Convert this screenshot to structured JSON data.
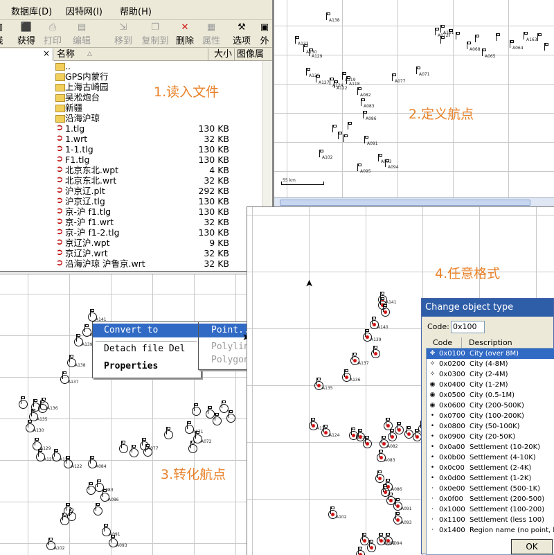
{
  "explorer": {
    "menu": [
      "数据库(D)",
      "因特网(I)",
      "帮助(H)"
    ],
    "toolbar": [
      {
        "label": "线",
        "icon": "gps-device-icon"
      },
      {
        "label": "获得",
        "icon": "gps-receiver-icon"
      },
      {
        "label": "打印",
        "icon": "printer-icon"
      },
      {
        "label": "编辑",
        "icon": "edit-icon"
      },
      {
        "label": "移到",
        "icon": "move-to-icon"
      },
      {
        "label": "复制到",
        "icon": "copy-to-icon"
      },
      {
        "label": "删除",
        "icon": "delete-icon"
      },
      {
        "label": "属性",
        "icon": "properties-icon"
      },
      {
        "label": "选项",
        "icon": "options-icon"
      },
      {
        "label": "外",
        "icon": "external-icon"
      }
    ],
    "pane_close": "×",
    "columns": {
      "name": "名称",
      "size": "大小",
      "attr": "图像属"
    },
    "files": [
      {
        "name": "..",
        "size": "",
        "kind": "folder"
      },
      {
        "name": "GPS内蒙行",
        "size": "",
        "kind": "folder"
      },
      {
        "name": "上海古崎园",
        "size": "",
        "kind": "folder"
      },
      {
        "name": "吴淞炮台",
        "size": "",
        "kind": "folder"
      },
      {
        "name": "新疆",
        "size": "",
        "kind": "folder"
      },
      {
        "name": "沿海沪琼",
        "size": "",
        "kind": "folder"
      },
      {
        "name": "1.tlg",
        "size": "130 KB",
        "kind": "gps"
      },
      {
        "name": "1.wrt",
        "size": "32 KB",
        "kind": "gps"
      },
      {
        "name": "1-1.tlg",
        "size": "130 KB",
        "kind": "gps"
      },
      {
        "name": "F1.tlg",
        "size": "130 KB",
        "kind": "gps"
      },
      {
        "name": "北京东北.wpt",
        "size": "4 KB",
        "kind": "gps"
      },
      {
        "name": "北京东北.wrt",
        "size": "32 KB",
        "kind": "gps"
      },
      {
        "name": "沪京辽.plt",
        "size": "292 KB",
        "kind": "gps"
      },
      {
        "name": "沪京辽.tlg",
        "size": "130 KB",
        "kind": "gps"
      },
      {
        "name": "京-沪 f1.tlg",
        "size": "130 KB",
        "kind": "gps"
      },
      {
        "name": "京-沪 f1.wrt",
        "size": "32 KB",
        "kind": "gps"
      },
      {
        "name": "京-沪 f1-2.tlg",
        "size": "130 KB",
        "kind": "gps"
      },
      {
        "name": "京辽沪.wpt",
        "size": "9 KB",
        "kind": "gps"
      },
      {
        "name": "京辽沪.wrt",
        "size": "32 KB",
        "kind": "gps"
      },
      {
        "name": "沿海沪琼 沪鲁京.wrt",
        "size": "32 KB",
        "kind": "gps"
      }
    ]
  },
  "steps": {
    "s1": "1.读入文件",
    "s2": "2.定义航点",
    "s3": "3.转化航点",
    "s4": "4.任意格式"
  },
  "map2": {
    "scale": "55 km",
    "labels": [
      "A138",
      "A133",
      "A130",
      "A129",
      "A128",
      "A127",
      "A124",
      "A122",
      "A119",
      "A118",
      "A082",
      "A083",
      "A086",
      "A077",
      "A071",
      "A072",
      "A068",
      "A065",
      "A064",
      "A163",
      "A101",
      "A091",
      "A093",
      "A094",
      "A095",
      "A102"
    ]
  },
  "map3": {
    "labels": [
      "A141",
      "A140",
      "A139",
      "A138",
      "A137",
      "A136",
      "A135",
      "A130",
      "A129",
      "A127",
      "A124",
      "A122",
      "A084",
      "A083",
      "A086",
      "A077",
      "A071",
      "A072",
      "A091",
      "A093",
      "A102"
    ]
  },
  "context_menu": {
    "items": [
      "Convert to",
      "Detach file  Del",
      "Properties"
    ],
    "submenu": [
      "Point...",
      "Polyline",
      "Polygon"
    ]
  },
  "map4": {
    "labels": [
      "A141",
      "A140",
      "A139",
      "A137",
      "A136",
      "A135",
      "A127",
      "A124",
      "A122",
      "A083",
      "A082",
      "A086",
      "A091",
      "A093",
      "A094",
      "A095",
      "A102"
    ]
  },
  "dialog": {
    "title": "Change object type",
    "code_label": "Code:",
    "code_value": "0x100",
    "col_code": "Code",
    "col_desc": "Description",
    "ok": "OK",
    "rows": [
      {
        "code": "0x0100",
        "desc": "City (over 8M)",
        "sym": "✥"
      },
      {
        "code": "0x0200",
        "desc": "City (4-8M)",
        "sym": "✧"
      },
      {
        "code": "0x0300",
        "desc": "City (2-4M)",
        "sym": "✧"
      },
      {
        "code": "0x0400",
        "desc": "City (1-2M)",
        "sym": "◉"
      },
      {
        "code": "0x0500",
        "desc": "City (0.5-1M)",
        "sym": "◉"
      },
      {
        "code": "0x0600",
        "desc": "City (200-500K)",
        "sym": "◉"
      },
      {
        "code": "0x0700",
        "desc": "City (100-200K)",
        "sym": "•"
      },
      {
        "code": "0x0800",
        "desc": "City (50-100K)",
        "sym": "•"
      },
      {
        "code": "0x0900",
        "desc": "City (20-50K)",
        "sym": "•"
      },
      {
        "code": "0x0a00",
        "desc": "Settlement (10-20K)",
        "sym": "•"
      },
      {
        "code": "0x0b00",
        "desc": "Settlement (4-10K)",
        "sym": "•"
      },
      {
        "code": "0x0c00",
        "desc": "Settlement (2-4K)",
        "sym": "•"
      },
      {
        "code": "0x0d00",
        "desc": "Settlement (1-2K)",
        "sym": "•"
      },
      {
        "code": "0x0e00",
        "desc": "Settlement (500-1K)",
        "sym": "·"
      },
      {
        "code": "0x0f00",
        "desc": "Settlement (200-500)",
        "sym": "·"
      },
      {
        "code": "0x1000",
        "desc": "Settlement (100-200)",
        "sym": "·"
      },
      {
        "code": "0x1100",
        "desc": "Settlement (less 100)",
        "sym": "·"
      },
      {
        "code": "0x1400",
        "desc": "Region name (no point, big)",
        "sym": "·"
      }
    ]
  }
}
